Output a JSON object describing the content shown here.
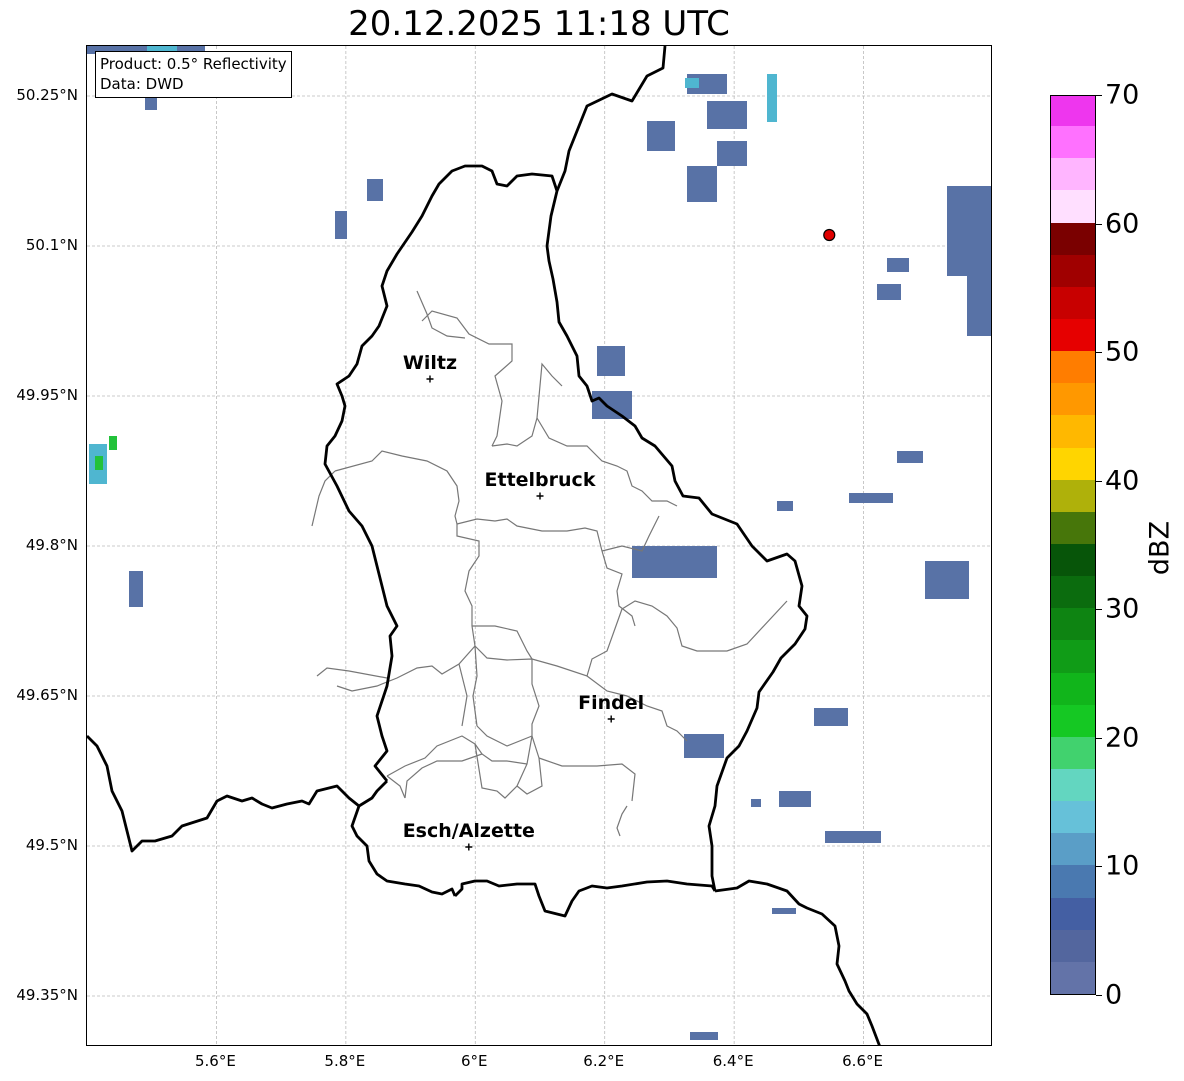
{
  "title": "20.12.2025 11:18 UTC",
  "info": {
    "product": "Product: 0.5° Reflectivity",
    "data": "Data: DWD"
  },
  "lat_labels": [
    "50.25°N",
    "50.1°N",
    "49.95°N",
    "49.8°N",
    "49.65°N",
    "49.5°N",
    "49.35°N"
  ],
  "lon_labels": [
    "5.6°E",
    "5.8°E",
    "6°E",
    "6.2°E",
    "6.4°E",
    "6.6°E"
  ],
  "cities": [
    {
      "name": "Wiltz",
      "lon": 5.93,
      "lat": 49.967
    },
    {
      "name": "Ettelbruck",
      "lon": 6.1,
      "lat": 49.85
    },
    {
      "name": "Findel",
      "lon": 6.21,
      "lat": 49.627
    },
    {
      "name": "Esch/Alzette",
      "lon": 5.99,
      "lat": 49.499
    }
  ],
  "station_marker": {
    "lon": 6.547,
    "lat": 50.111,
    "color": "#e00000"
  },
  "colorbar": {
    "label": "dBZ",
    "ticks": [
      "0",
      "10",
      "20",
      "30",
      "40",
      "50",
      "60",
      "70"
    ],
    "colors": [
      "#6373a8",
      "#53669e",
      "#445fa3",
      "#4a79b0",
      "#5a9ec7",
      "#66c1d9",
      "#63d6c0",
      "#41d26e",
      "#15c823",
      "#11b51b",
      "#109c17",
      "#0e8412",
      "#0b6c0e",
      "#075509",
      "#47760a",
      "#afb10a",
      "#ffd500",
      "#ffb800",
      "#ff9800",
      "#ff7d00",
      "#e60000",
      "#c80000",
      "#a00000",
      "#7a0000",
      "#ffdfff",
      "#ffb5ff",
      "#ff71ff",
      "#ee36ee"
    ]
  }
}
